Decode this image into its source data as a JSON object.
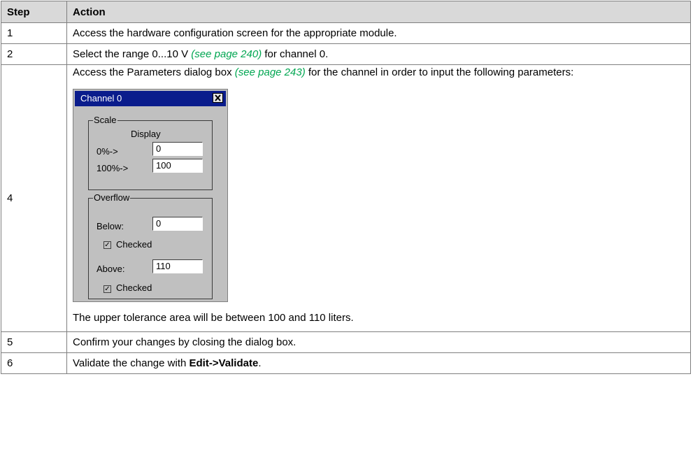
{
  "table": {
    "header": {
      "step": "Step",
      "action": "Action"
    },
    "rows": [
      {
        "step": "1",
        "text": "Access the hardware configuration screen for the appropriate module."
      },
      {
        "step": "2",
        "pre": "Select the range 0...10 V ",
        "link": "(see page 240)",
        "post": " for channel 0."
      },
      {
        "step": "4",
        "pre": "Access the Parameters dialog box ",
        "link": "(see page 243)",
        "post": " for the channel in order to input the following parameters:",
        "after": "The upper tolerance area will be between 100 and 110 liters."
      },
      {
        "step": "5",
        "text": "Confirm your changes by closing the dialog box."
      },
      {
        "step": "6",
        "pre": "Validate the change with ",
        "bold": "Edit->Validate",
        "post": "."
      }
    ]
  },
  "dialog": {
    "title": "Channel 0",
    "close_icon": "close-x-icon",
    "scale": {
      "legend": "Scale",
      "display_label": "Display",
      "row0_label": "0%->",
      "row0_value": "0",
      "row100_label": "100%->",
      "row100_value": "100"
    },
    "overflow": {
      "legend": "Overflow",
      "below_label": "Below:",
      "below_value": "0",
      "below_checked_label": "Checked",
      "below_checked": true,
      "above_label": "Above:",
      "above_value": "110",
      "above_checked_label": "Checked",
      "above_checked": true
    }
  }
}
